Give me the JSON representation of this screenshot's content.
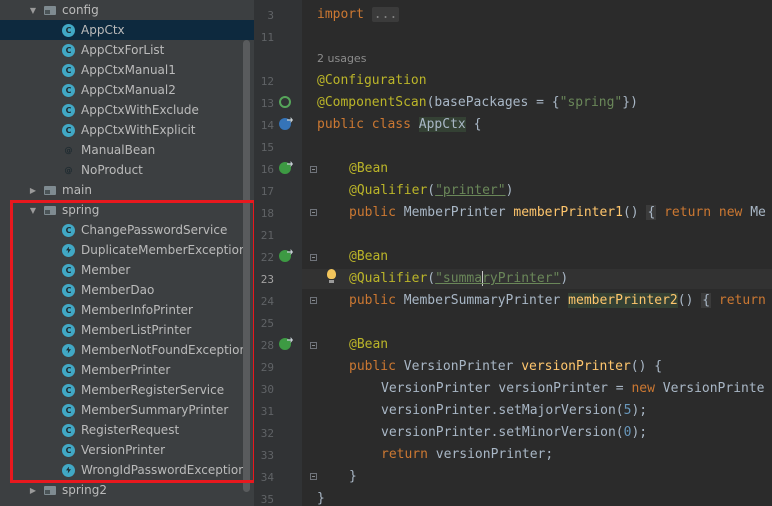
{
  "tree": {
    "config_folder": "config",
    "config_items": [
      {
        "label": "AppCtx",
        "kind": "class",
        "selected": true
      },
      {
        "label": "AppCtxForList",
        "kind": "class"
      },
      {
        "label": "AppCtxManual1",
        "kind": "class"
      },
      {
        "label": "AppCtxManual2",
        "kind": "class"
      },
      {
        "label": "AppCtxWithExclude",
        "kind": "class"
      },
      {
        "label": "AppCtxWithExplicit",
        "kind": "class"
      },
      {
        "label": "ManualBean",
        "kind": "annotation"
      },
      {
        "label": "NoProduct",
        "kind": "annotation"
      }
    ],
    "main_folder": "main",
    "spring_folder": "spring",
    "spring_items": [
      {
        "label": "ChangePasswordService",
        "kind": "class"
      },
      {
        "label": "DuplicateMemberException",
        "kind": "exception"
      },
      {
        "label": "Member",
        "kind": "class"
      },
      {
        "label": "MemberDao",
        "kind": "class"
      },
      {
        "label": "MemberInfoPrinter",
        "kind": "class"
      },
      {
        "label": "MemberListPrinter",
        "kind": "class"
      },
      {
        "label": "MemberNotFoundException",
        "kind": "exception"
      },
      {
        "label": "MemberPrinter",
        "kind": "class"
      },
      {
        "label": "MemberRegisterService",
        "kind": "class"
      },
      {
        "label": "MemberSummaryPrinter",
        "kind": "class"
      },
      {
        "label": "RegisterRequest",
        "kind": "class"
      },
      {
        "label": "VersionPrinter",
        "kind": "class"
      },
      {
        "label": "WrongIdPasswordException",
        "kind": "exception"
      }
    ],
    "spring2_folder": "spring2",
    "highlight_color": "#e8181e"
  },
  "gutter": {
    "line_numbers": [
      "3",
      "11",
      "12",
      "13",
      "14",
      "15",
      "16",
      "17",
      "18",
      "21",
      "22",
      "23",
      "24",
      "25",
      "28",
      "29",
      "30",
      "31",
      "32",
      "33",
      "34",
      "35"
    ],
    "current_line": "23"
  },
  "code": {
    "import_kw": "import",
    "import_folded": "...",
    "usages": "2 usages",
    "configuration": "@Configuration",
    "component_scan": "@ComponentScan",
    "base_packages_open": "(basePackages = {",
    "base_packages_value": "\"spring\"",
    "base_packages_close": "})",
    "public": "public",
    "class": "class",
    "class_name": "AppCtx",
    "open_brace": "{",
    "bean": "@Bean",
    "qualifier": "@Qualifier",
    "q1_value": "\"printer\"",
    "q2_value_a": "\"summa",
    "q2_value_b": "ryPrinter\"",
    "paren_open": "(",
    "paren_close": ")",
    "m1_type": "MemberPrinter",
    "m1_name": "memberPrinter1",
    "m1_rest": "() ",
    "return": "return",
    "new": "new",
    "m1_tail": "Me",
    "m2_type": "MemberSummaryPrinter",
    "m2_name": "memberPrinter2",
    "m3_type": "VersionPrinter",
    "m3_name": "versionPrinter",
    "m3_rest": "() {",
    "local_decl": "VersionPrinter versionPrinter = ",
    "local_tail": "VersionPrinte",
    "set_major": "versionPrinter.setMajorVersion(",
    "major_val": "5",
    "set_minor": "versionPrinter.setMinorVersion(",
    "minor_val": "0",
    "call_close": ");",
    "return_var": "versionPrinter;",
    "close_brace": "}"
  }
}
